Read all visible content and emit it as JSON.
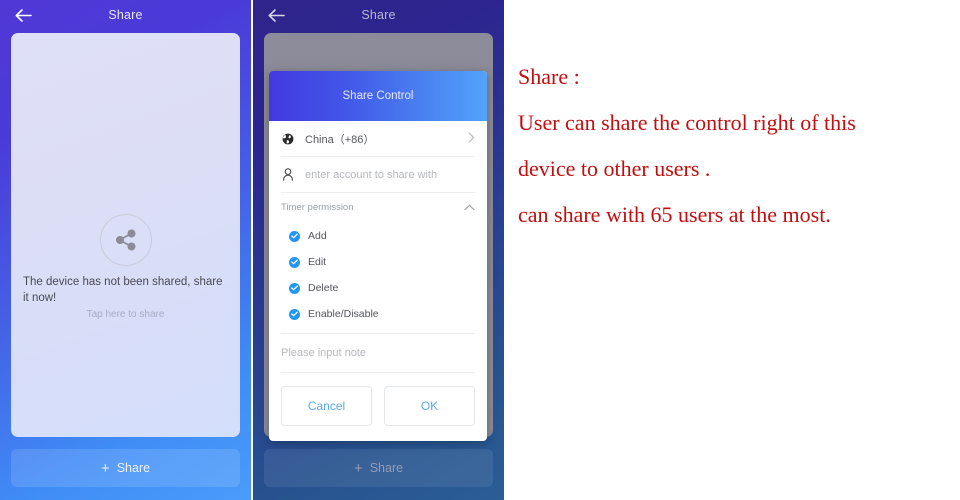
{
  "panel_one": {
    "header": {
      "title": "Share",
      "back_icon": "arrow-left-icon"
    },
    "empty_state": {
      "icon": "share-nodes-icon",
      "message": "The device has not been shared, share it now!",
      "hint": "Tap here to share"
    },
    "share_button": {
      "label": "Share",
      "icon": "plus-icon"
    }
  },
  "panel_two": {
    "header": {
      "title": "Share",
      "back_icon": "arrow-left-icon"
    },
    "share_button": {
      "label": "Share",
      "icon": "plus-icon"
    },
    "dialog": {
      "title": "Share Control",
      "country_row": {
        "icon": "globe-icon",
        "value": "China（+86）",
        "chevron": "chevron-right-icon"
      },
      "account_row": {
        "icon": "person-icon",
        "placeholder": "enter account to share with"
      },
      "permission_section": {
        "title": "Timer permission",
        "chevron": "chevron-up-icon"
      },
      "permissions": [
        {
          "label": "Add",
          "checked": true
        },
        {
          "label": "Edit",
          "checked": true
        },
        {
          "label": "Delete",
          "checked": true
        },
        {
          "label": "Enable/Disable",
          "checked": true
        }
      ],
      "note_row": {
        "placeholder": "Please input note"
      },
      "cancel_label": "Cancel",
      "ok_label": "OK"
    }
  },
  "annotation": {
    "line1": "Share :",
    "line2": "User can share the control right of this",
    "line3": "device to other users .",
    "line4": "can share with 65 users at the most."
  },
  "colors": {
    "panel_one_gradient_start": "#5038d6",
    "panel_one_gradient_end": "#4a9bfb",
    "panel_two_gradient_start": "#2e2489",
    "panel_two_gradient_end": "#2b5d96",
    "dialog_header_start": "#4338e0",
    "dialog_header_end": "#53a3fb",
    "checkbox_blue": "#2196f3",
    "dialog_button_text": "#5ba9ef",
    "annotation_red": "#c10f10"
  }
}
